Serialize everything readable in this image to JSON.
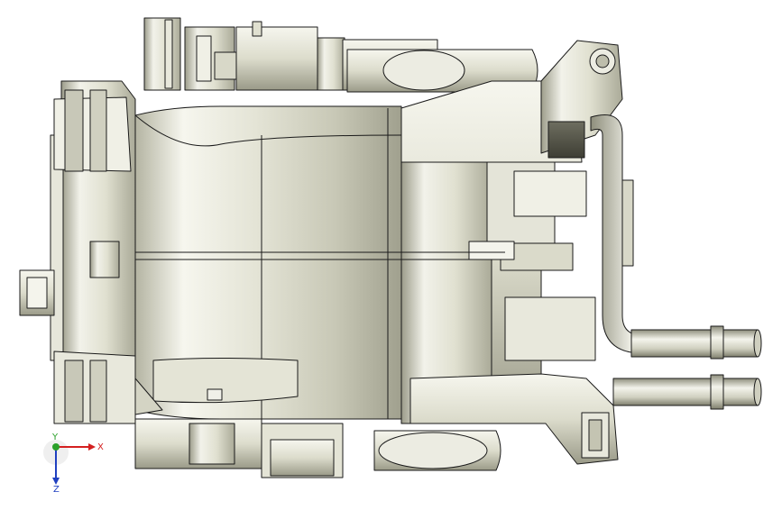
{
  "triad": {
    "x_label": "X",
    "y_label": "Y",
    "z_label": "Z",
    "colors": {
      "x": "#d42020",
      "y": "#2aa02a",
      "z": "#2040c0"
    }
  },
  "palette": {
    "background": "#ffffff",
    "metal_light": "#f4f4ec",
    "metal_mid": "#d6d6c6",
    "metal_dark": "#8c8c7a",
    "edge": "#1a1a1a"
  }
}
